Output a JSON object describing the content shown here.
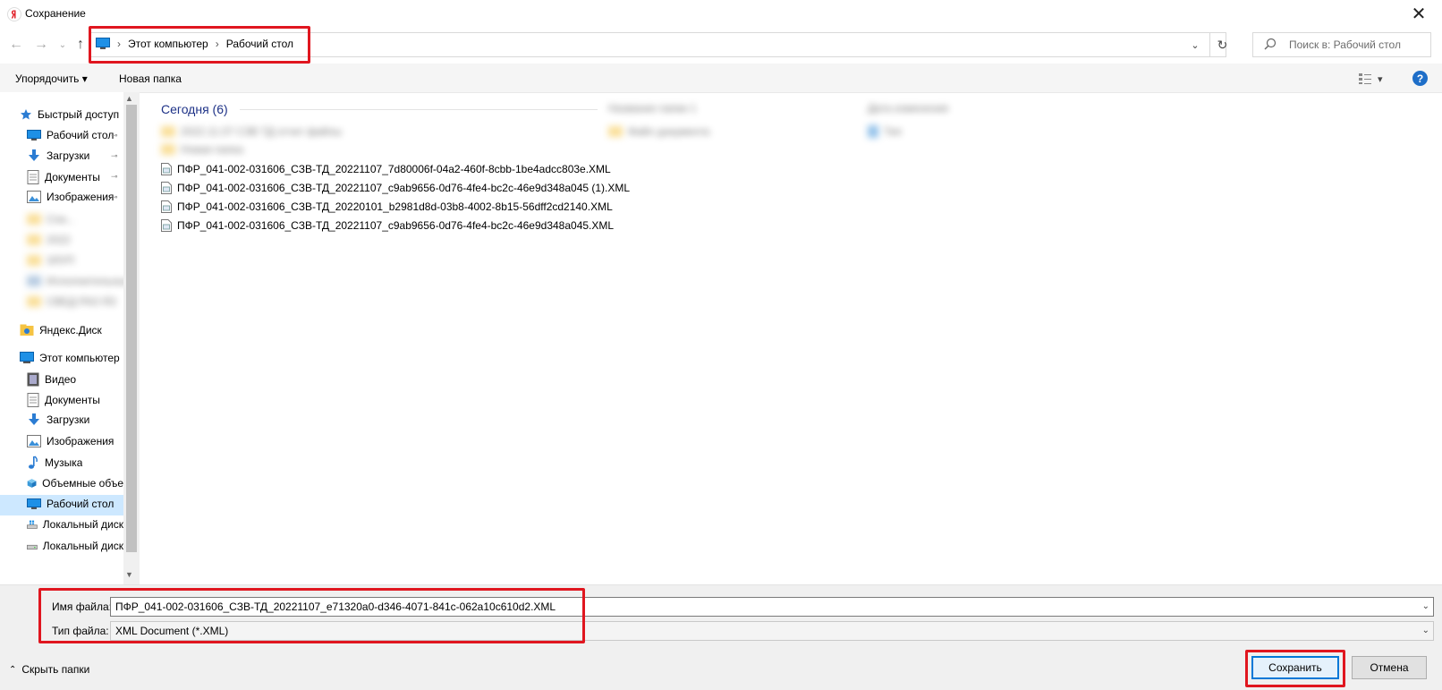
{
  "window": {
    "title": "Сохранение",
    "close_glyph": "✕"
  },
  "nav": {
    "back_glyph": "←",
    "forward_glyph": "→",
    "recent_glyph": "⌄",
    "up_glyph": "↑",
    "breadcrumb": [
      "Этот компьютер",
      "Рабочий стол"
    ],
    "breadcrumb_sep": "›",
    "dropdown_glyph": "⌄",
    "refresh_glyph": "↻",
    "search_placeholder": "Поиск в: Рабочий стол"
  },
  "toolbar": {
    "organize_label": "Упорядочить ▾",
    "new_folder_label": "Новая папка",
    "view_glyph": "▾",
    "help_glyph": "?"
  },
  "sidebar": {
    "quick_access": "Быстрый доступ",
    "quick_items": [
      "Рабочий стол",
      "Загрузки",
      "Документы",
      "Изображения"
    ],
    "blurred_items": [
      "Спи...",
      "2022",
      "ЗЛУП",
      "Исполнительные",
      "СВЕД РАЗ ЯЗ"
    ],
    "yandex_disk": "Яндекс.Диск",
    "this_pc": "Этот компьютер",
    "pc_items": [
      "Видео",
      "Документы",
      "Загрузки",
      "Изображения",
      "Музыка",
      "Объемные объе",
      "Рабочий стол",
      "Локальный диск",
      "Локальный диск"
    ],
    "selected_item": "Рабочий стол",
    "pin_glyph": "📌"
  },
  "main": {
    "group_header": "Сегодня (6)",
    "blurred_folders": [
      "2022.11.07 СЗВ ТД отчет файлы",
      "Новая папка"
    ],
    "blurred_right": [
      "Название папки 1",
      "Дата изменения",
      "Файл документа",
      "Тип"
    ],
    "files": [
      "ПФР_041-002-031606_СЗВ-ТД_20221107_7d80006f-04a2-460f-8cbb-1be4adcc803e.XML",
      "ПФР_041-002-031606_СЗВ-ТД_20221107_c9ab9656-0d76-4fe4-bc2c-46e9d348a045 (1).XML",
      "ПФР_041-002-031606_СЗВ-ТД_20220101_b2981d8d-03b8-4002-8b15-56dff2cd2140.XML",
      "ПФР_041-002-031606_СЗВ-ТД_20221107_c9ab9656-0d76-4fe4-bc2c-46e9d348a045.XML"
    ]
  },
  "form": {
    "filename_label": "Имя файла:",
    "filename_value": "ПФР_041-002-031606_СЗВ-ТД_20221107_e71320a0-d346-4071-841c-062a10c610d2.XML",
    "filetype_label": "Тип файла:",
    "filetype_value": "XML Document (*.XML)",
    "combo_glyph": "⌄"
  },
  "footer": {
    "hide_folders_label": "Скрыть папки",
    "hide_folders_glyph": "⌃",
    "save_label": "Сохранить",
    "cancel_label": "Отмена"
  },
  "colors": {
    "highlight": "#e0161f",
    "accent": "#0078d7",
    "header_text": "#1e3287"
  }
}
